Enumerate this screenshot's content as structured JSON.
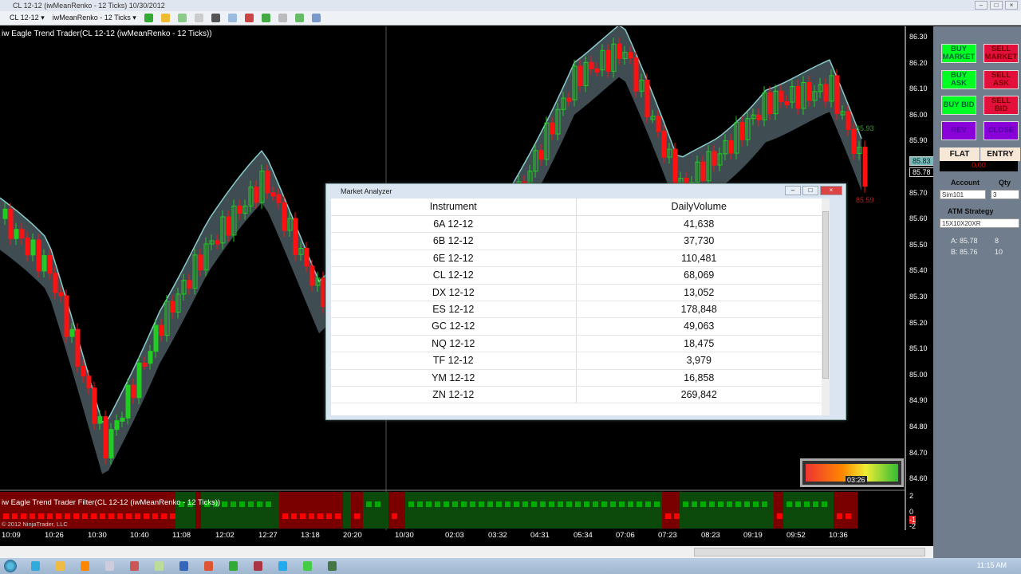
{
  "window": {
    "title": "CL 12-12 (iwMeanRenko - 12 Ticks)  10/30/2012",
    "controls": [
      "minimize",
      "restore",
      "close"
    ]
  },
  "toolbar": {
    "instrument": "CL 12-12 ▾",
    "bar_type": "iwMeanRenko - 12 Ticks ▾"
  },
  "chart": {
    "title": "iw Eagle Trend Trader(CL 12-12 (iwMeanRenko - 12 Ticks))",
    "filter_title": "iw Eagle Trend Trader Filter(CL 12-12 (iwMeanRenko - 12 Ticks))",
    "copyright": "© 2012 NinjaTrader, LLC",
    "price_ticks": [
      "86.30",
      "86.20",
      "86.10",
      "86.00",
      "85.90",
      "85.70",
      "85.60",
      "85.50",
      "85.40",
      "85.30",
      "85.20",
      "85.10",
      "85.00",
      "84.90",
      "84.80",
      "84.70",
      "84.60"
    ],
    "time_ticks": [
      "10:09",
      "10:26",
      "10:30",
      "10:40",
      "11:08",
      "12:02",
      "12:27",
      "13:18",
      "20:20",
      "10/30",
      "02:03",
      "03:32",
      "04:31",
      "05:34",
      "07:06",
      "07:23",
      "08:23",
      "09:19",
      "09:52",
      "10:36"
    ],
    "last_price": "85.83",
    "ask_tag": "85.78",
    "high_label": "85.93",
    "low_label": "85.59",
    "filter_ticks": [
      "2",
      "0",
      "-1",
      "-2"
    ],
    "timer": "03:26",
    "colors": {
      "up": "#22cc22",
      "down": "#ff1111",
      "band": "#4a5a62",
      "filter_up": "#0b4a0b",
      "filter_down": "#7a0000"
    }
  },
  "panel": {
    "buy_market": "BUY MARKET",
    "sell_market": "SELL MARKET",
    "buy_ask": "BUY ASK",
    "sell_ask": "SELL ASK",
    "buy_bid": "BUY BID",
    "sell_bid": "SELL BID",
    "rev": "REV",
    "close": "CLOSE",
    "flat": "FLAT",
    "entry": "ENTRY",
    "pnl": "0.00",
    "account_label": "Account",
    "qty_label": "Qty",
    "account": "Sim101",
    "qty": "3",
    "atm_label": "ATM Strategy",
    "atm": "15X10X20XR",
    "ask": "A: 85.78",
    "ask_size": "8",
    "bid": "B: 85.76",
    "bid_size": "10"
  },
  "analyzer": {
    "title": "Market Analyzer",
    "columns": [
      "Instrument",
      "DailyVolume"
    ],
    "rows": [
      [
        "6A 12-12",
        "41,638"
      ],
      [
        "6B 12-12",
        "37,730"
      ],
      [
        "6E 12-12",
        "110,481"
      ],
      [
        "CL 12-12",
        "68,069"
      ],
      [
        "DX 12-12",
        "13,052"
      ],
      [
        "ES 12-12",
        "178,848"
      ],
      [
        "GC 12-12",
        "49,063"
      ],
      [
        "NQ 12-12",
        "18,475"
      ],
      [
        "TF 12-12",
        "3,979"
      ],
      [
        "YM 12-12",
        "16,858"
      ],
      [
        "ZN 12-12",
        "269,842"
      ]
    ]
  },
  "taskbar": {
    "clock": "11:15 AM",
    "apps": [
      "internet-explorer",
      "explorer",
      "media-player",
      "file",
      "paint",
      "notepad",
      "word",
      "powerpoint",
      "excel",
      "ninjatrader",
      "skype",
      "chrome",
      "camtasia"
    ]
  }
}
